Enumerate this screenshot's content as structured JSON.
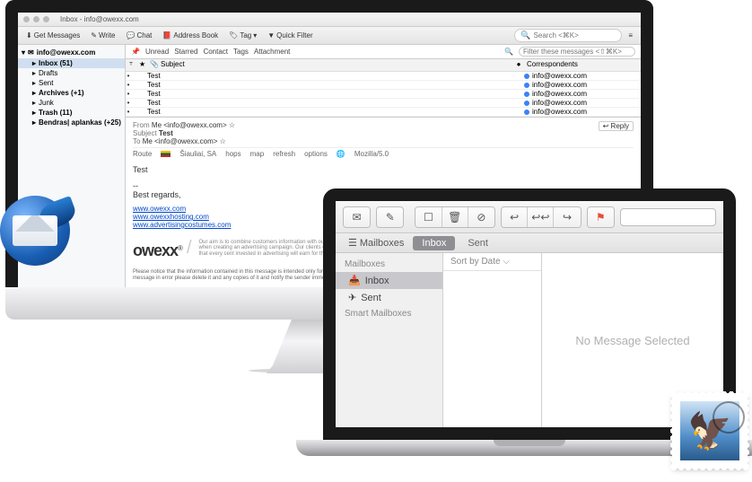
{
  "thunderbird": {
    "title": "Inbox - info@owexx.com",
    "toolbar": {
      "get_messages": "Get Messages",
      "write": "Write",
      "chat": "Chat",
      "address_book": "Address Book",
      "tag": "Tag",
      "quick_filter": "Quick Filter",
      "search_placeholder": "Search <⌘K>"
    },
    "account": "info@owexx.com",
    "folders": [
      {
        "label": "Inbox (51)",
        "bold": true,
        "selected": true
      },
      {
        "label": "Drafts"
      },
      {
        "label": "Sent"
      },
      {
        "label": "Archives (+1)",
        "bold": true
      },
      {
        "label": "Junk"
      },
      {
        "label": "Trash (11)",
        "bold": true
      },
      {
        "label": "Bendras| aplankas (+25)",
        "bold": true
      }
    ],
    "filter": {
      "unread": "Unread",
      "starred": "Starred",
      "contact": "Contact",
      "tags": "Tags",
      "attachment": "Attachment",
      "placeholder": "Filter these messages <⇧⌘K>"
    },
    "columns": {
      "subject": "Subject",
      "correspondents": "Correspondents"
    },
    "messages": [
      {
        "subject": "Test",
        "from": "info@owexx.com"
      },
      {
        "subject": "Test",
        "from": "info@owexx.com"
      },
      {
        "subject": "Test",
        "from": "info@owexx.com"
      },
      {
        "subject": "Test",
        "from": "info@owexx.com"
      },
      {
        "subject": "Test",
        "from": "info@owexx.com"
      }
    ],
    "preview": {
      "from_label": "From",
      "from": "Me <info@owexx.com>",
      "subject_label": "Subject",
      "subject": "Test",
      "to_label": "To",
      "to": "Me <info@owexx.com>",
      "reply": "Reply",
      "route": {
        "location": "Šiauliai, SA",
        "hops": "hops",
        "map": "map",
        "refresh": "refresh",
        "options": "options",
        "ua": "Mozilla/5.0"
      },
      "body": "Test",
      "signoff": "Best regards,",
      "links": [
        "www.owexx.com",
        "www.owexxhosting.com",
        "www.advertisingcostumes.com"
      ],
      "brand": "owexx",
      "tagline": "Our aim is to combine customers information with our experience when creating an advertising campaign. Our clients can be sure that every cent invested in advertising will earn for them.",
      "disclaimer": "Please notice that the information contained in this message is intended only for use of the individual(s) named above and contains information that may be privileged and confidential. If you have received this message in error please delete it and any copies of it and notify the sender immediately. Thank You."
    }
  },
  "macmail": {
    "tabs": {
      "mailboxes": "Mailboxes",
      "inbox": "Inbox",
      "sent": "Sent"
    },
    "sidebar": {
      "section1": "Mailboxes",
      "inbox": "Inbox",
      "sent": "Sent",
      "section2": "Smart Mailboxes"
    },
    "sort": "Sort by Date",
    "empty": "No Message Selected"
  }
}
